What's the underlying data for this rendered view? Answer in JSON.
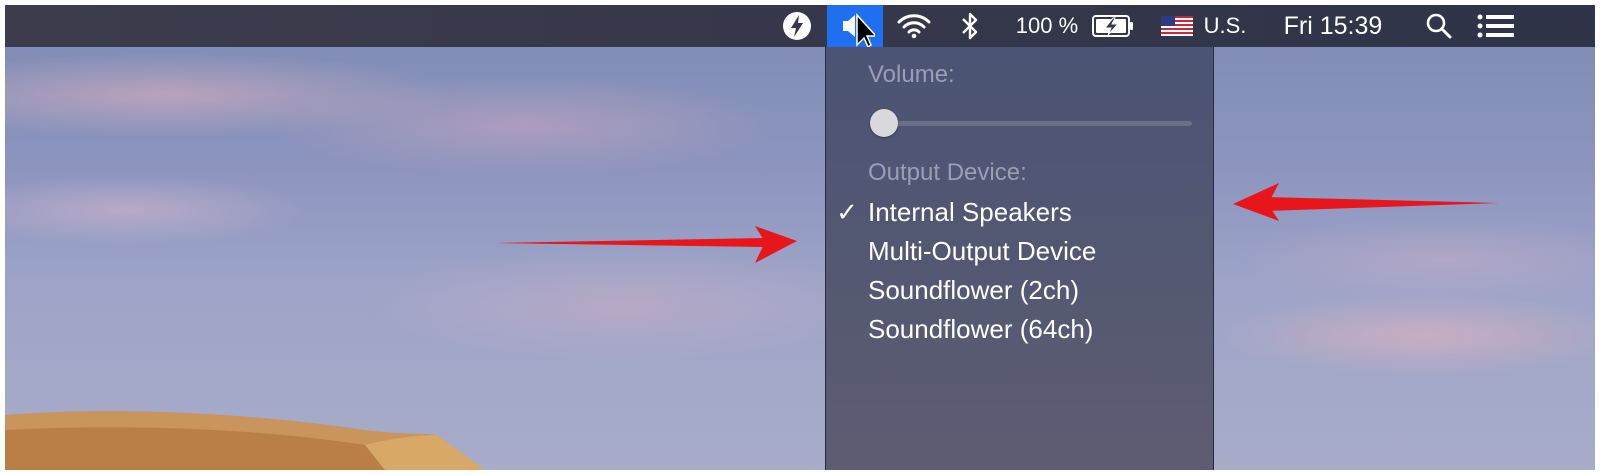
{
  "menubar": {
    "icons": [
      "flash-icon",
      "volume-icon",
      "wifi-icon",
      "bluetooth-icon",
      "battery-icon",
      "us-flag-icon",
      "search-icon",
      "list-icon"
    ],
    "battery_percent": "100 %",
    "input_source": "U.S.",
    "clock": "Fri 15:39",
    "active_color": "#1f6ff1"
  },
  "sound_menu": {
    "volume_label": "Volume:",
    "volume_level": 0,
    "output_label": "Output Device:",
    "checkmark": "✓",
    "devices": [
      {
        "label": "Internal Speakers",
        "selected": true
      },
      {
        "label": "Multi-Output Device",
        "selected": false
      },
      {
        "label": "Soundflower (2ch)",
        "selected": false
      },
      {
        "label": "Soundflower (64ch)",
        "selected": false
      }
    ]
  },
  "annotations": {
    "arrow_color": "#e8151b"
  }
}
